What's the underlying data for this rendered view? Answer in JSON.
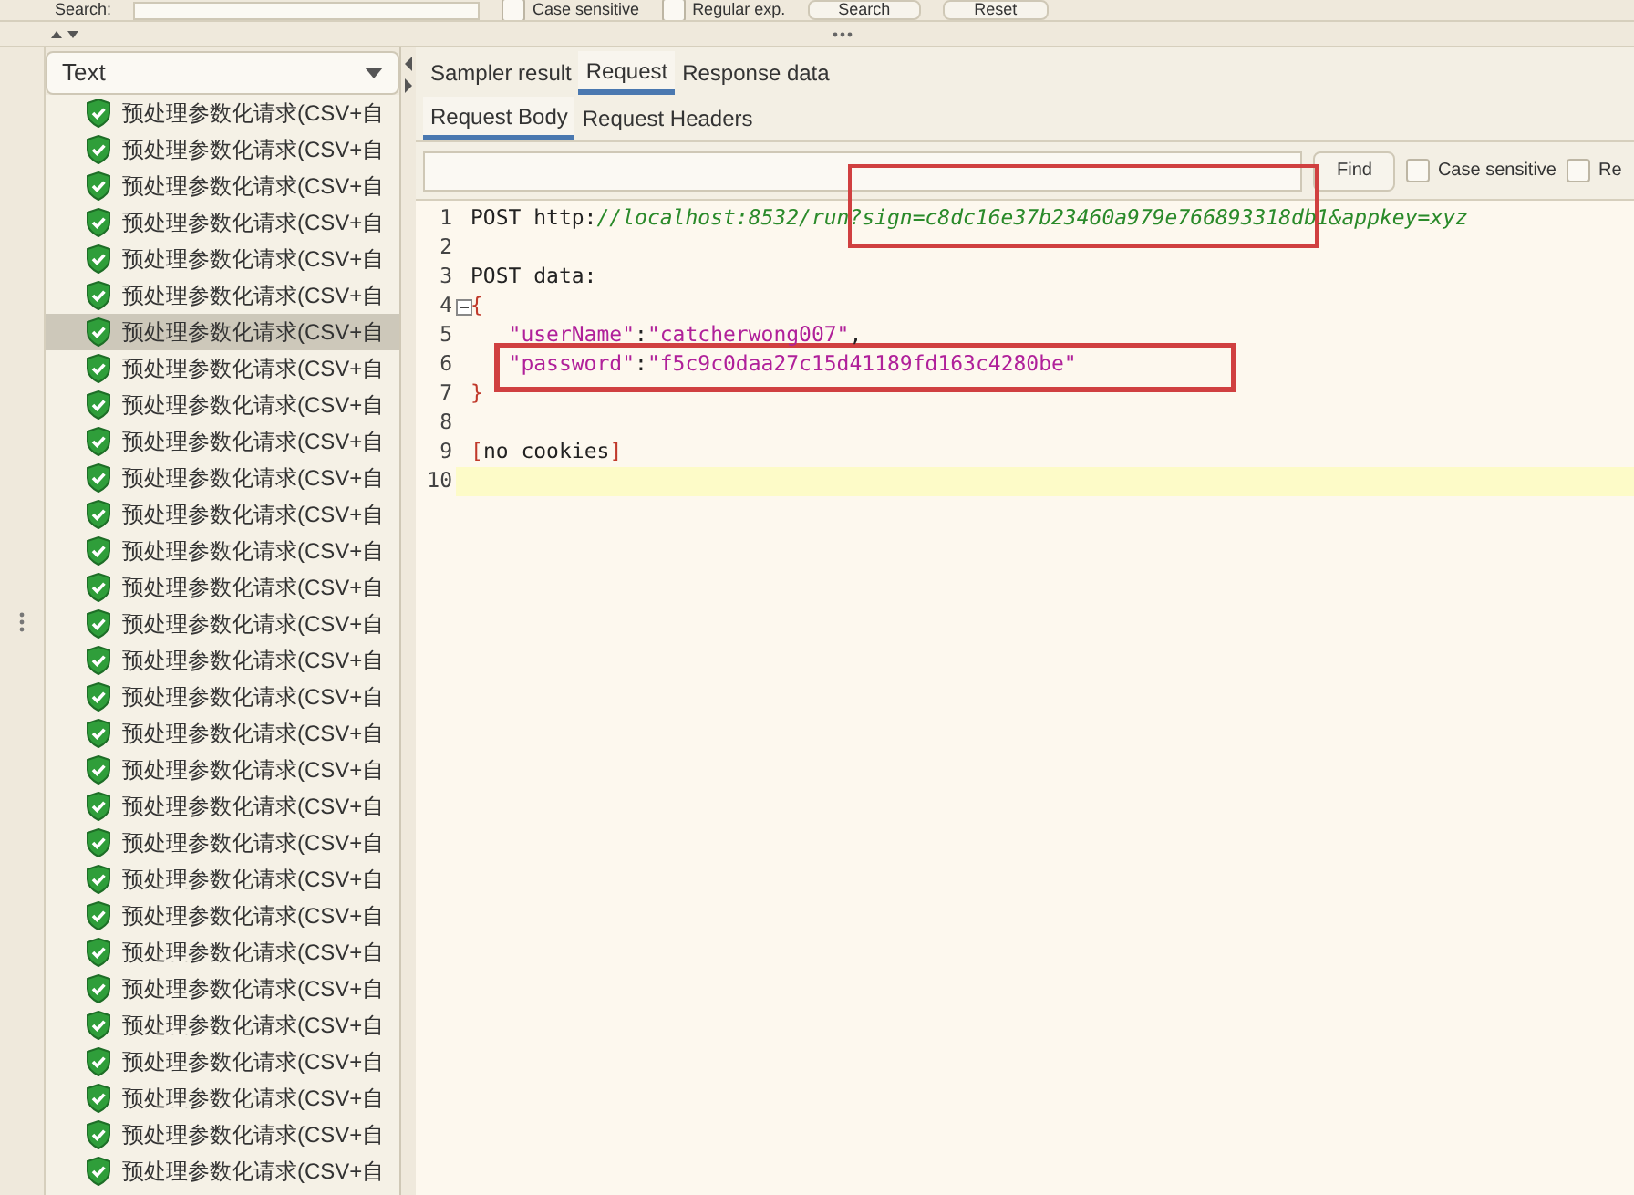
{
  "search_bar": {
    "label": "Search:",
    "checkboxes": [
      {
        "label": "Case sensitive",
        "checked": false
      },
      {
        "label": "Regular exp.",
        "checked": false
      }
    ],
    "buttons": [
      "Search",
      "Reset"
    ]
  },
  "left_panel": {
    "renderer": "Text",
    "items": [
      {
        "label": "预处理参数化请求(CSV+自",
        "selected": false
      },
      {
        "label": "预处理参数化请求(CSV+自",
        "selected": false
      },
      {
        "label": "预处理参数化请求(CSV+自",
        "selected": false
      },
      {
        "label": "预处理参数化请求(CSV+自",
        "selected": false
      },
      {
        "label": "预处理参数化请求(CSV+自",
        "selected": false
      },
      {
        "label": "预处理参数化请求(CSV+自",
        "selected": false
      },
      {
        "label": "预处理参数化请求(CSV+自",
        "selected": true
      },
      {
        "label": "预处理参数化请求(CSV+自",
        "selected": false
      },
      {
        "label": "预处理参数化请求(CSV+自",
        "selected": false
      },
      {
        "label": "预处理参数化请求(CSV+自",
        "selected": false
      },
      {
        "label": "预处理参数化请求(CSV+自",
        "selected": false
      },
      {
        "label": "预处理参数化请求(CSV+自",
        "selected": false
      },
      {
        "label": "预处理参数化请求(CSV+自",
        "selected": false
      },
      {
        "label": "预处理参数化请求(CSV+自",
        "selected": false
      },
      {
        "label": "预处理参数化请求(CSV+自",
        "selected": false
      },
      {
        "label": "预处理参数化请求(CSV+自",
        "selected": false
      },
      {
        "label": "预处理参数化请求(CSV+自",
        "selected": false
      },
      {
        "label": "预处理参数化请求(CSV+自",
        "selected": false
      },
      {
        "label": "预处理参数化请求(CSV+自",
        "selected": false
      },
      {
        "label": "预处理参数化请求(CSV+自",
        "selected": false
      },
      {
        "label": "预处理参数化请求(CSV+自",
        "selected": false
      },
      {
        "label": "预处理参数化请求(CSV+自",
        "selected": false
      },
      {
        "label": "预处理参数化请求(CSV+自",
        "selected": false
      },
      {
        "label": "预处理参数化请求(CSV+自",
        "selected": false
      },
      {
        "label": "预处理参数化请求(CSV+自",
        "selected": false
      },
      {
        "label": "预处理参数化请求(CSV+自",
        "selected": false
      },
      {
        "label": "预处理参数化请求(CSV+自",
        "selected": false
      },
      {
        "label": "预处理参数化请求(CSV+自",
        "selected": false
      },
      {
        "label": "预处理参数化请求(CSV+自",
        "selected": false
      },
      {
        "label": "预处理参数化请求(CSV+自",
        "selected": false
      }
    ]
  },
  "tabs": [
    {
      "label": "Sampler result",
      "selected": false
    },
    {
      "label": "Request",
      "selected": true
    },
    {
      "label": "Response data",
      "selected": false
    }
  ],
  "subtabs": [
    {
      "label": "Request Body",
      "selected": true
    },
    {
      "label": "Request Headers",
      "selected": false
    }
  ],
  "find_bar": {
    "button": "Find",
    "checkboxes": [
      {
        "label": "Case sensitive",
        "checked": false
      },
      {
        "label": "Re",
        "checked": false
      }
    ]
  },
  "editor": {
    "lines": [
      {
        "number": "1",
        "segments": [
          {
            "kind": "plain",
            "text": "POST http:"
          },
          {
            "kind": "url",
            "text": "//localhost:8532/run?sign=c8dc16e37b23460a979e766893318db1&appkey=xyz"
          }
        ]
      },
      {
        "number": "2"
      },
      {
        "number": "3",
        "segments": [
          {
            "kind": "plain",
            "text": "POST data:"
          }
        ]
      },
      {
        "number": "4",
        "foldable": true,
        "segments": [
          {
            "kind": "bracket",
            "text": "{"
          }
        ]
      },
      {
        "number": "5",
        "segments": [
          {
            "kind": "string",
            "text": "   \"userName\""
          },
          {
            "kind": "plain",
            "text": ":"
          },
          {
            "kind": "string",
            "text": "\"catcherwong007\""
          },
          {
            "kind": "plain",
            "text": ","
          }
        ]
      },
      {
        "number": "6",
        "segments": [
          {
            "kind": "string",
            "text": "   \"password\""
          },
          {
            "kind": "plain",
            "text": ":"
          },
          {
            "kind": "string",
            "text": "\"f5c9c0daa27c15d41189fd163c4280be\""
          }
        ]
      },
      {
        "number": "7",
        "segments": [
          {
            "kind": "bracket",
            "text": "}"
          }
        ]
      },
      {
        "number": "8"
      },
      {
        "number": "9",
        "segments": [
          {
            "kind": "bracket",
            "text": "["
          },
          {
            "kind": "plain",
            "text": "no cookies"
          },
          {
            "kind": "bracket",
            "text": "]"
          }
        ]
      },
      {
        "number": "10",
        "current": true
      }
    ]
  }
}
